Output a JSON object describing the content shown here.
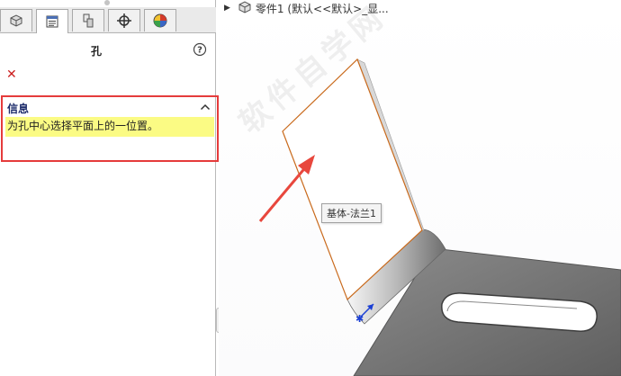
{
  "panel": {
    "title": "孔",
    "info_header": "信息",
    "info_message": "为孔中心选择平面上的一位置。"
  },
  "tabs": [
    {
      "icon": "feature-manager-icon"
    },
    {
      "icon": "property-manager-icon",
      "active": true
    },
    {
      "icon": "configuration-manager-icon"
    },
    {
      "icon": "dimxpert-icon"
    },
    {
      "icon": "appearance-icon"
    }
  ],
  "tree": {
    "breadcrumb": "零件1  (默认<<默认>_显..."
  },
  "viewport": {
    "feature_tooltip": "基体-法兰1",
    "watermark": "软件自学网"
  },
  "colors": {
    "highlight_border": "#e53b3b",
    "message_bg": "#fbfb84",
    "close_red": "#cc1f1f",
    "arrow_red": "#e8473d",
    "edge_orange": "#c96a1c"
  }
}
